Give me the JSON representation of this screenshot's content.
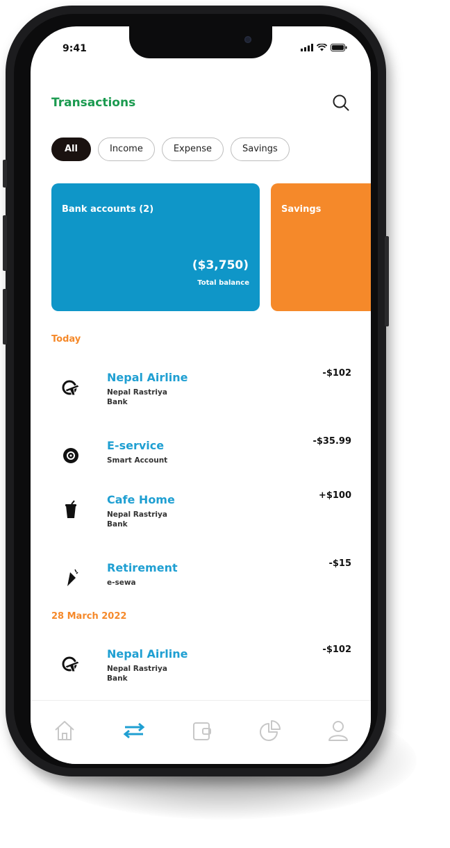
{
  "status": {
    "time": "9:41"
  },
  "header": {
    "title": "Transactions"
  },
  "filters": [
    {
      "label": "All",
      "active": true
    },
    {
      "label": "Income",
      "active": false
    },
    {
      "label": "Expense",
      "active": false
    },
    {
      "label": "Savings",
      "active": false
    }
  ],
  "cards": {
    "bank": {
      "title": "Bank accounts (2)",
      "amount": "($3,750)",
      "subtitle": "Total balance"
    },
    "savings": {
      "title": "Savings"
    }
  },
  "sections": [
    {
      "date": "Today"
    },
    {
      "date": "28 March 2022"
    }
  ],
  "transactions": [
    {
      "icon": "plane-icon",
      "name": "Nepal Airline",
      "account": "Nepal Rastriya Bank",
      "amount": "-$102"
    },
    {
      "icon": "coin-icon",
      "name": "E-service",
      "account": "Smart Account",
      "amount": "-$35.99"
    },
    {
      "icon": "cup-icon",
      "name": "Cafe Home",
      "account": "Nepal Rastriya Bank",
      "amount": "+$100"
    },
    {
      "icon": "rocket-icon",
      "name": "Retirement",
      "account": "e-sewa",
      "amount": "-$15"
    },
    {
      "icon": "plane-icon",
      "name": "Nepal Airline",
      "account": "Nepal Rastriya Bank",
      "amount": "-$102"
    }
  ],
  "tabbar": {
    "tabs": [
      "home-icon",
      "transfer-icon",
      "wallet-icon",
      "pie-chart-icon",
      "profile-icon"
    ],
    "active_color": "#1f9fd2",
    "inactive_color": "#c7c7c7"
  },
  "colors": {
    "accent_green": "#1a9a4f",
    "accent_blue": "#0f96c8",
    "accent_orange": "#f5892a"
  }
}
